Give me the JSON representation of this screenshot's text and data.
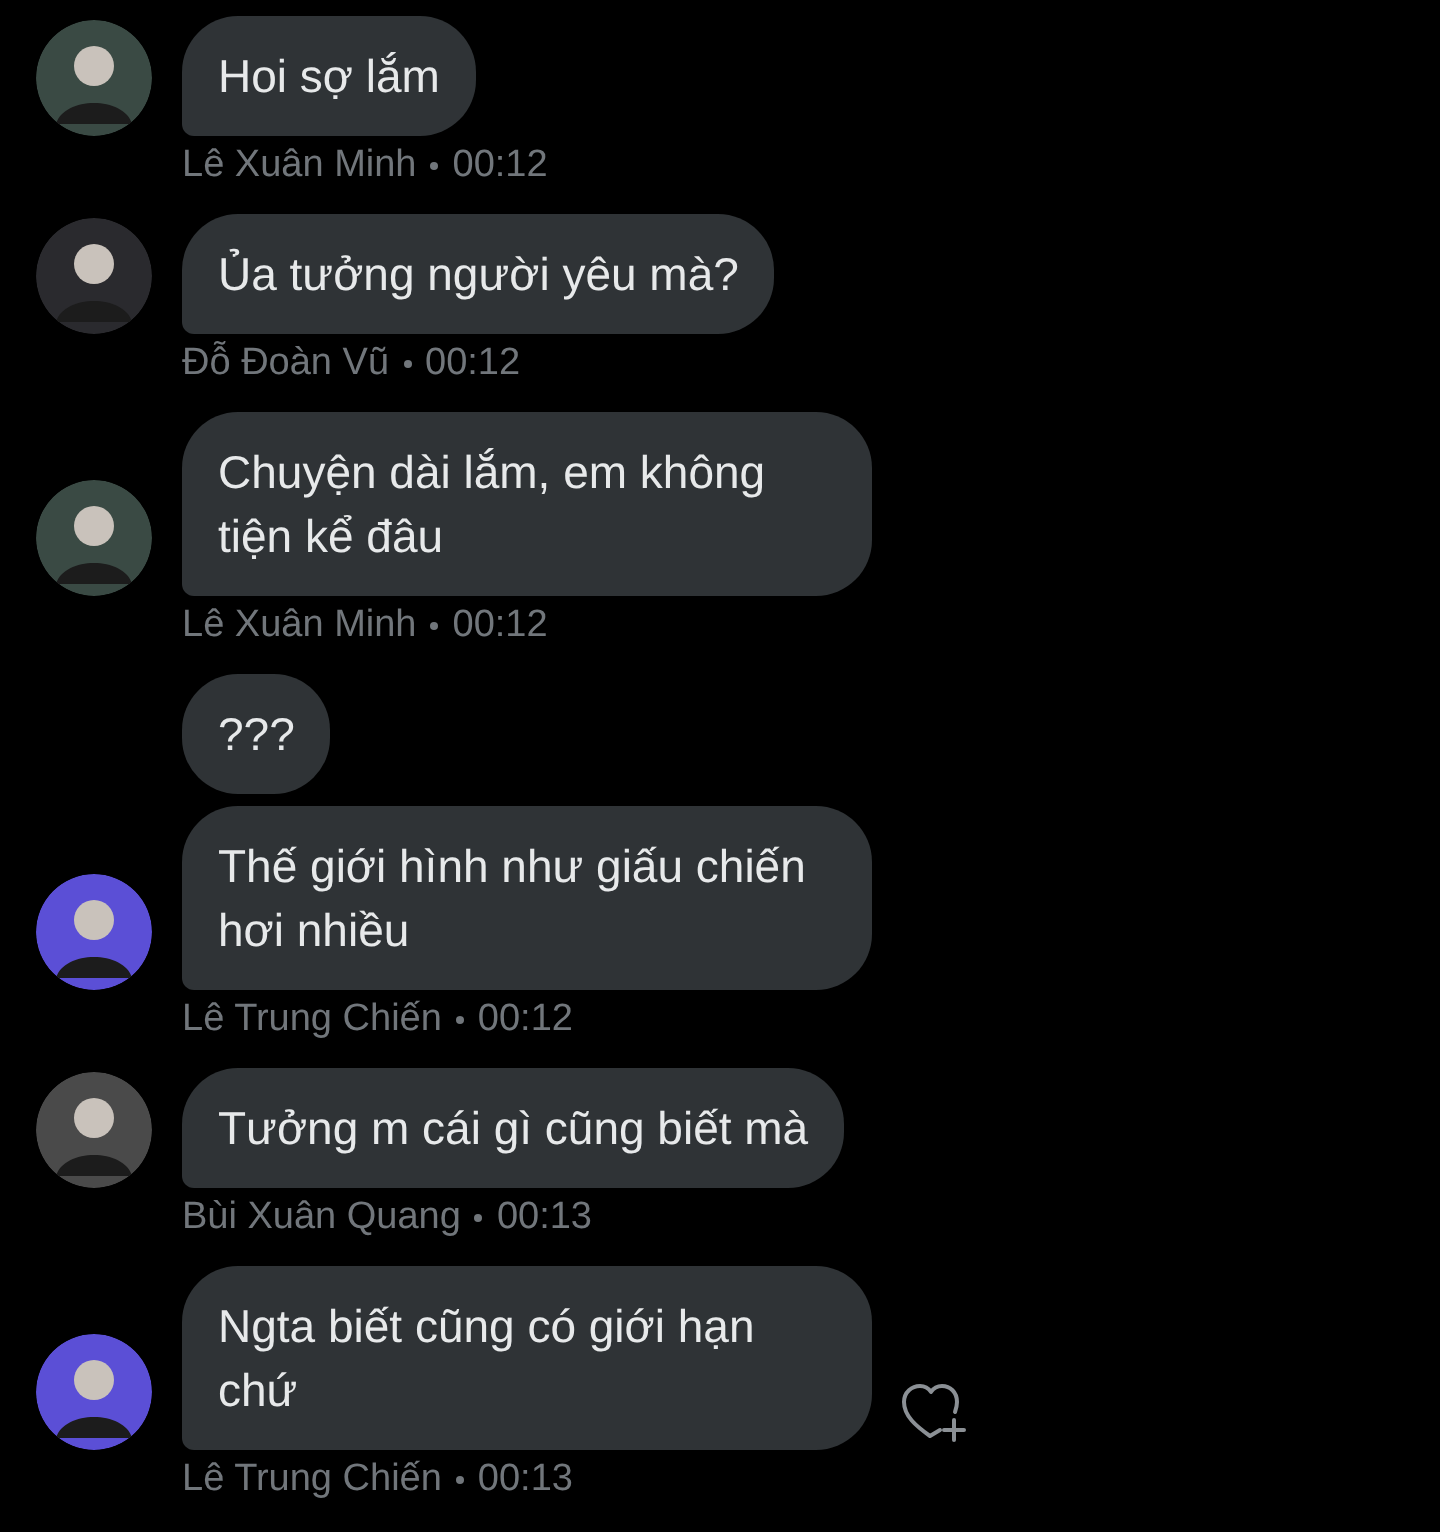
{
  "messages": [
    {
      "sender": "Lê Xuân Minh",
      "time": "00:12",
      "color": "#3a4a44",
      "like_button": false,
      "bubbles": [
        "Hoi sợ lắm"
      ]
    },
    {
      "sender": "Đỗ Đoàn Vũ",
      "time": "00:12",
      "color": "#2a2a2e",
      "like_button": false,
      "bubbles": [
        "Ủa tưởng người yêu mà?"
      ]
    },
    {
      "sender": "Lê Xuân Minh",
      "time": "00:12",
      "color": "#3a4a44",
      "like_button": false,
      "bubbles": [
        "Chuyện dài lắm, em không tiện kể đâu"
      ]
    },
    {
      "sender": "Lê Trung Chiến",
      "time": "00:12",
      "color": "#5b4fd6",
      "like_button": false,
      "bubbles": [
        "???",
        "Thế giới hình như giấu chiến hơi nhiều"
      ]
    },
    {
      "sender": "Bùi Xuân Quang",
      "time": "00:13",
      "color": "#4a4a4a",
      "like_button": false,
      "bubbles": [
        "Tưởng m cái gì cũng biết mà"
      ]
    },
    {
      "sender": "Lê Trung Chiến",
      "time": "00:13",
      "color": "#5b4fd6",
      "like_button": true,
      "bubbles": [
        "Ngta biết cũng có giới hạn chứ"
      ]
    }
  ]
}
